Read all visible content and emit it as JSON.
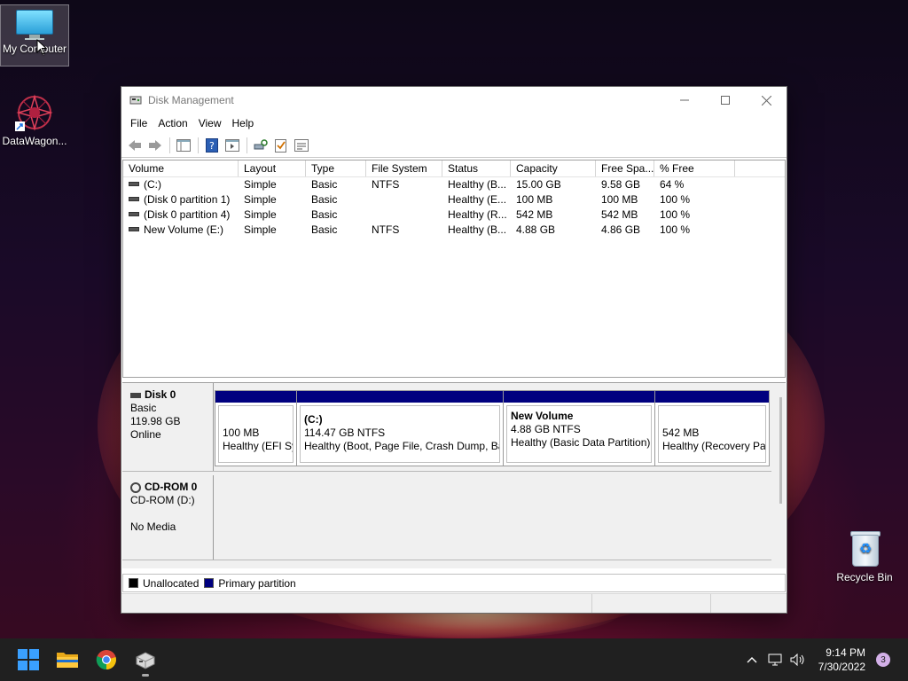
{
  "desktop": {
    "icons": [
      {
        "label": "My Computer"
      },
      {
        "label": "DataWagon..."
      },
      {
        "label": "Recycle Bin"
      }
    ]
  },
  "window": {
    "title": "Disk Management",
    "menu": [
      "File",
      "Action",
      "View",
      "Help"
    ],
    "list": {
      "columns": [
        "Volume",
        "Layout",
        "Type",
        "File System",
        "Status",
        "Capacity",
        "Free Spa...",
        "% Free",
        ""
      ],
      "rows": [
        [
          "(C:)",
          "Simple",
          "Basic",
          "NTFS",
          "Healthy (B...",
          "15.00 GB",
          "9.58 GB",
          "64 %"
        ],
        [
          "(Disk 0 partition 1)",
          "Simple",
          "Basic",
          "",
          "Healthy (E...",
          "100 MB",
          "100 MB",
          "100 %"
        ],
        [
          "(Disk 0 partition 4)",
          "Simple",
          "Basic",
          "",
          "Healthy (R...",
          "542 MB",
          "542 MB",
          "100 %"
        ],
        [
          "New Volume (E:)",
          "Simple",
          "Basic",
          "NTFS",
          "Healthy (B...",
          "4.88 GB",
          "4.86 GB",
          "100 %"
        ]
      ]
    },
    "disks": [
      {
        "name": "Disk 0",
        "type": "Basic",
        "size": "119.98 GB",
        "state": "Online",
        "partitions": [
          {
            "name": "",
            "size": "100 MB",
            "status": "Healthy (EFI Sy"
          },
          {
            "name": "(C:)",
            "size": "114.47 GB NTFS",
            "status": "Healthy (Boot, Page File, Crash Dump, Ba"
          },
          {
            "name": "New Volume",
            "size": "4.88 GB NTFS",
            "status": "Healthy (Basic Data Partition)"
          },
          {
            "name": "",
            "size": "542 MB",
            "status": "Healthy (Recovery Pa"
          }
        ]
      },
      {
        "name": "CD-ROM 0",
        "type": "CD-ROM (D:)",
        "size": "",
        "state": "No Media"
      }
    ],
    "legend": [
      {
        "label": "Unallocated",
        "color": "#000000"
      },
      {
        "label": "Primary partition",
        "color": "#00007f"
      }
    ]
  },
  "taskbar": {
    "clock_time": "9:14 PM",
    "clock_date": "7/30/2022",
    "notifications": "3"
  },
  "colors": {
    "primary_partition": "#00007f",
    "taskbar": "#202020"
  }
}
